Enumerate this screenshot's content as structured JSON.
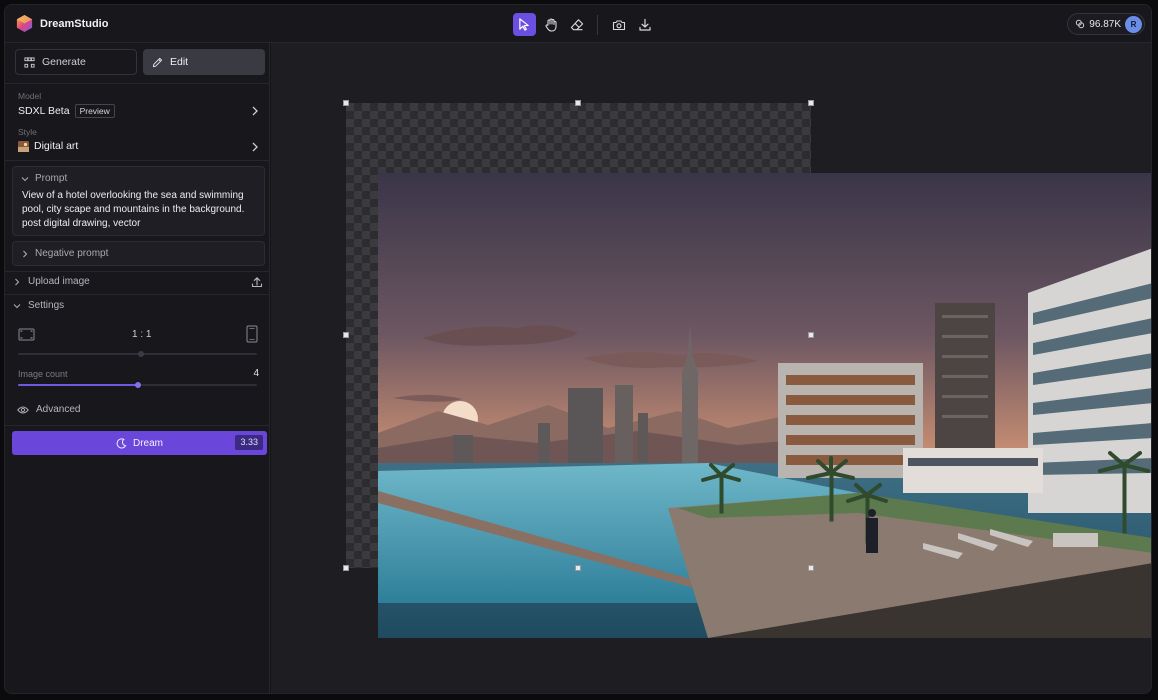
{
  "app": {
    "name": "DreamStudio"
  },
  "toolbar": {
    "tools": [
      {
        "name": "select-tool",
        "icon": "cursor-arrow-icon",
        "active": true
      },
      {
        "name": "hand-tool",
        "icon": "hand-icon",
        "active": false
      },
      {
        "name": "eraser-tool",
        "icon": "eraser-icon",
        "active": false
      },
      {
        "name": "camera-tool",
        "icon": "camera-icon",
        "active": false
      },
      {
        "name": "download-tool",
        "icon": "download-icon",
        "active": false
      }
    ],
    "credits": "96.87K",
    "avatar_initial": "R"
  },
  "sidebar": {
    "modes": [
      {
        "label": "Generate",
        "icon": "grid-icon",
        "active": false
      },
      {
        "label": "Edit",
        "icon": "pencil-icon",
        "active": true
      }
    ],
    "model": {
      "label": "Model",
      "value": "SDXL Beta",
      "badge": "Preview"
    },
    "style": {
      "label": "Style",
      "value": "Digital art"
    },
    "prompt": {
      "header": "Prompt",
      "text": "View of a hotel overlooking the sea and swimming pool, city scape and mountains in the background. post digital drawing, vector"
    },
    "negative_prompt": {
      "header": "Negative prompt"
    },
    "upload": {
      "label": "Upload image"
    },
    "settings": {
      "label": "Settings",
      "aspect_ratio": "1 : 1",
      "image_count_label": "Image count",
      "image_count": "4",
      "image_count_fraction": 0.5,
      "advanced_label": "Advanced"
    },
    "dream": {
      "label": "Dream",
      "cost": "3.33"
    }
  },
  "colors": {
    "accent": "#6a46da",
    "active_tool": "#6a4fe0"
  }
}
